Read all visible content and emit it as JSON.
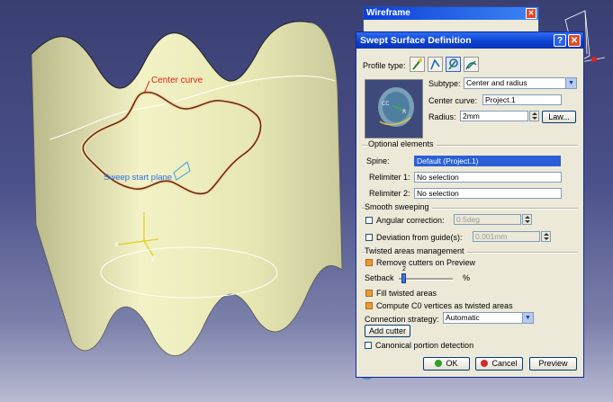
{
  "viewport": {
    "annotations": {
      "center_curve": "Center curve",
      "sweep_start_plane": "Sweep start plane"
    },
    "axis_labels": {
      "x": "x",
      "y": "y"
    }
  },
  "wireframe_toolbar": {
    "title": "Wireframe"
  },
  "dialog": {
    "title": "Swept Surface Definition",
    "help_glyph": "?",
    "close_glyph": "✕",
    "profile_type_label": "Profile type:",
    "subtype_label": "Subtype:",
    "subtype_value": "Center and radius",
    "center_curve_label": "Center curve:",
    "center_curve_value": "Project.1",
    "radius_label": "Radius:",
    "radius_value": "2mm",
    "law_button": "Law...",
    "preview_labels": {
      "cc": "CC",
      "r": "R"
    },
    "optional_elements": {
      "title": "Optional elements",
      "spine_label": "Spine:",
      "spine_value": "Default (Project.1)",
      "relimiter1_label": "Relimiter 1:",
      "relimiter1_value": "No selection",
      "relimiter2_label": "Relimiter 2:",
      "relimiter2_value": "No selection"
    },
    "smooth_sweeping": {
      "title": "Smooth sweeping",
      "angular_label": "Angular correction:",
      "angular_value": "0.5deg",
      "deviation_label": "Deviation from guide(s):",
      "deviation_value": "0.001mm"
    },
    "twisted_areas": {
      "title": "Twisted areas management",
      "remove_cutters_label": "Remove cutters on Preview",
      "setback_label": "Setback",
      "setback_value": "2",
      "setback_unit": "%",
      "fill_label": "Fill twisted areas",
      "compute_label": "Compute C0 vertices as twisted areas",
      "connection_label": "Connection strategy:",
      "connection_value": "Automatic",
      "add_cutter_button": "Add cutter"
    },
    "canonical_label": "Canonical portion detection",
    "ok_button": "OK",
    "cancel_button": "Cancel",
    "preview_button": "Preview"
  }
}
